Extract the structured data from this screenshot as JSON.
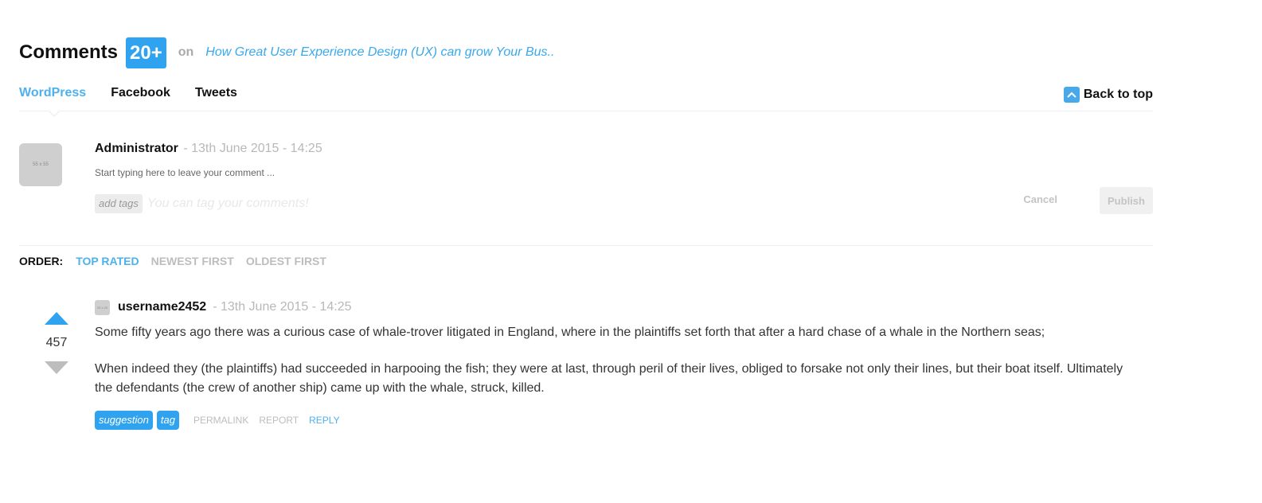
{
  "header": {
    "title": "Comments",
    "count": "20+",
    "on": "on",
    "post_title": "How Great User Experience Design (UX) can grow Your Bus.."
  },
  "tabs": [
    {
      "label": "WordPress",
      "active": true
    },
    {
      "label": "Facebook",
      "active": false
    },
    {
      "label": "Tweets",
      "active": false
    }
  ],
  "back_to_top": "Back to top",
  "compose": {
    "avatar_placeholder": "55 x 55",
    "author": "Administrator",
    "date": "- 13th June 2015 - 14:25",
    "prompt": "Start typing here to leave your comment ...",
    "add_tags": "add tags",
    "tag_placeholder": "You can tag your comments!",
    "cancel": "Cancel",
    "publish": "Publish"
  },
  "order": {
    "label": "ORDER:",
    "options": [
      {
        "label": "TOP RATED",
        "active": true
      },
      {
        "label": "NEWEST FIRST",
        "active": false
      },
      {
        "label": "OLDEST FIRST",
        "active": false
      }
    ]
  },
  "comment": {
    "avatar_placeholder": "20 x 20",
    "username": "username2452",
    "date": "- 13th June 2015 - 14:25",
    "score": "457",
    "paragraphs": [
      "Some fifty years ago there was a curious case of whale-trover litigated in England, where in the plaintiffs set forth that after a hard chase of a whale in the Northern seas;",
      "When indeed they (the plaintiffs) had succeeded in harpooing the fish; they were at last, through peril of their lives, obliged to forsake not only their lines, but their boat itself. Ultimately the defendants (the crew of another ship) came up with the whale, struck, killed."
    ],
    "tags": [
      "suggestion",
      "tag"
    ],
    "actions": {
      "permalink": "PERMALINK",
      "report": "REPORT",
      "reply": "REPLY"
    }
  },
  "colors": {
    "accent": "#2fa3f0",
    "link": "#4db1ee",
    "muted": "#bdbdbd"
  }
}
